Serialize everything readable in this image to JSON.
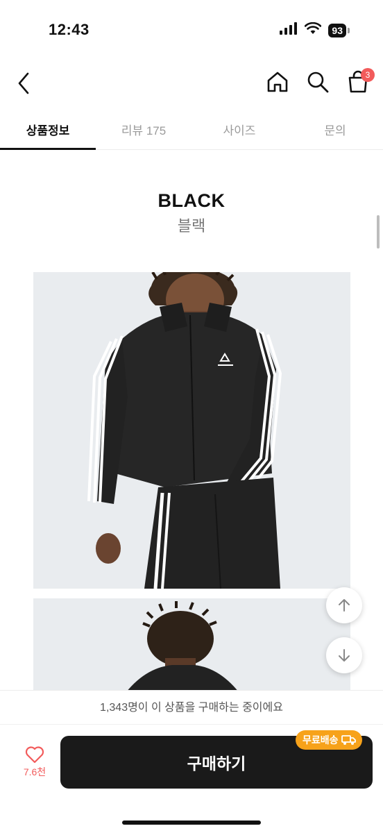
{
  "status_bar": {
    "time": "12:43",
    "battery": "93"
  },
  "nav": {
    "cart_count": "3"
  },
  "tabs": [
    {
      "label": "상품정보"
    },
    {
      "label": "리뷰 175"
    },
    {
      "label": "사이즈"
    },
    {
      "label": "문의"
    }
  ],
  "content": {
    "color_name_en": "BLACK",
    "color_name_ko": "블랙"
  },
  "banner": {
    "text": "1,343명이 이 상품을 구매하는 중이에요"
  },
  "bottom": {
    "like_count": "7.6천",
    "buy_label": "구매하기",
    "free_shipping_label": "무료배송"
  },
  "colors": {
    "accent_red": "#f25b5b",
    "free_ship_orange": "#f7a21a",
    "buy_button": "#1a1a1a"
  }
}
